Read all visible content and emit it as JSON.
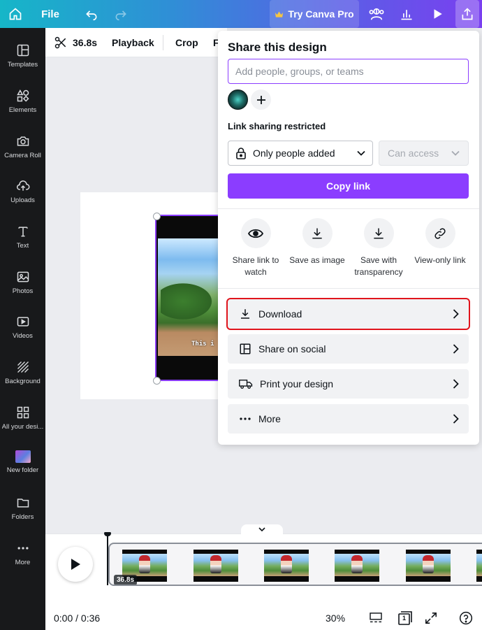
{
  "topbar": {
    "file_label": "File",
    "pro_label": "Try Canva Pro",
    "icons": [
      "home-icon",
      "undo-icon",
      "redo-icon",
      "crown-icon",
      "people-icon",
      "stats-icon",
      "present-icon",
      "share-icon"
    ]
  },
  "sidebar": {
    "items": [
      {
        "label": "Templates",
        "icon": "templates-icon"
      },
      {
        "label": "Elements",
        "icon": "elements-icon"
      },
      {
        "label": "Camera Roll",
        "icon": "camera-icon"
      },
      {
        "label": "Uploads",
        "icon": "upload-icon"
      },
      {
        "label": "Text",
        "icon": "text-icon"
      },
      {
        "label": "Photos",
        "icon": "photo-icon"
      },
      {
        "label": "Videos",
        "icon": "video-icon"
      },
      {
        "label": "Background",
        "icon": "background-icon"
      },
      {
        "label": "All your desi...",
        "icon": "grid-icon"
      },
      {
        "label": "New folder",
        "icon": "folder-thumbnail"
      },
      {
        "label": "Folders",
        "icon": "folder-icon"
      },
      {
        "label": "More",
        "icon": "more-icon"
      }
    ]
  },
  "editor_toolbar": {
    "duration": "36.8s",
    "playback_label": "Playback",
    "crop_label": "Crop",
    "truncated_label": "F"
  },
  "canvas": {
    "caption": "This i"
  },
  "share_panel": {
    "title": "Share this design",
    "input_placeholder": "Add people, groups, or teams",
    "link_sharing_label": "Link sharing restricted",
    "access_select_value": "Only people added",
    "permission_select_value": "Can access",
    "copy_link_label": "Copy link",
    "options": [
      {
        "label": "Share link to watch",
        "icon": "eye-icon"
      },
      {
        "label": "Save as image",
        "icon": "download-icon"
      },
      {
        "label": "Save with transparency",
        "icon": "download-icon"
      },
      {
        "label": "View-only link",
        "icon": "link-icon"
      }
    ],
    "rows": [
      {
        "label": "Download",
        "icon": "download-icon",
        "highlighted": true
      },
      {
        "label": "Share on social",
        "icon": "social-icon",
        "highlighted": false
      },
      {
        "label": "Print your design",
        "icon": "truck-icon",
        "highlighted": false
      },
      {
        "label": "More",
        "icon": "more-icon",
        "highlighted": false
      }
    ],
    "accent_color": "#8b3dff",
    "highlight_color": "#e0141c"
  },
  "timeline": {
    "clip_duration": "36.8s",
    "time_display": "0:00 / 0:36",
    "zoom_level": "30%",
    "page_count": "1"
  }
}
